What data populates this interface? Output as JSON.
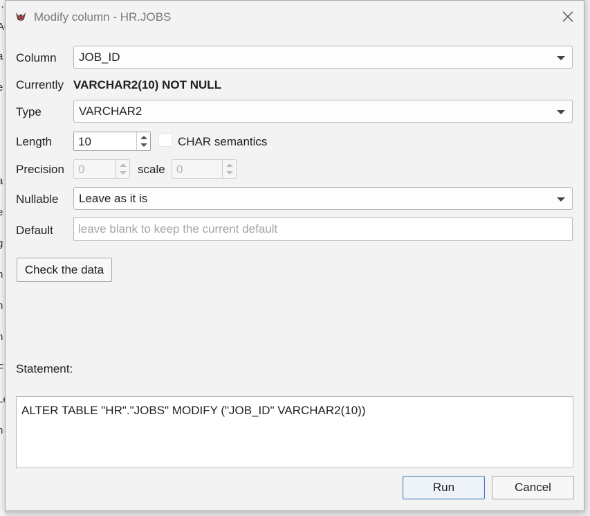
{
  "window": {
    "title": "Modify column - HR.JOBS",
    "app_icon": "dbeaver-logo-icon"
  },
  "background_fragments": [
    "…",
    "Ac",
    "a",
    "e",
    "i",
    "i",
    "a",
    "e",
    "g",
    "n",
    "n",
    "n",
    "F",
    "Le",
    "n"
  ],
  "form": {
    "column": {
      "label": "Column",
      "value": "JOB_ID"
    },
    "currently": {
      "label": "Currently",
      "value": "VARCHAR2(10) NOT NULL"
    },
    "type": {
      "label": "Type",
      "value": "VARCHAR2"
    },
    "length": {
      "label": "Length",
      "value": "10"
    },
    "char_semantics": {
      "label": "CHAR semantics",
      "checked": false
    },
    "precision": {
      "label": "Precision",
      "value": "0"
    },
    "scale": {
      "label": "scale",
      "value": "0"
    },
    "nullable": {
      "label": "Nullable",
      "value": "Leave as it is"
    },
    "default": {
      "label": "Default",
      "value": "",
      "placeholder": "leave blank to keep the current default"
    }
  },
  "check_button_label": "Check the data",
  "statement": {
    "label": "Statement:",
    "text": "ALTER TABLE \"HR\".\"JOBS\" MODIFY (\"JOB_ID\" VARCHAR2(10))"
  },
  "buttons": {
    "run": "Run",
    "cancel": "Cancel"
  },
  "colors": {
    "accent": "#4c7ebd",
    "dialog_bg": "#f3f3f3",
    "placeholder": "#a4a4a4"
  }
}
